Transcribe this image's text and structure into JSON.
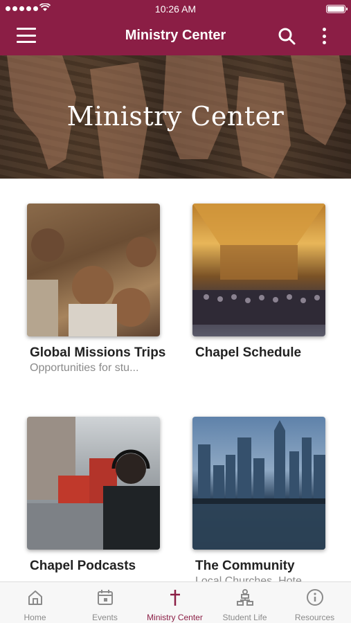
{
  "status_bar": {
    "time": "10:26 AM"
  },
  "nav": {
    "title": "Ministry Center"
  },
  "hero": {
    "title": "Ministry Center"
  },
  "cards": [
    {
      "title": "Global Missions Trips",
      "subtitle": "Opportunities for stu..."
    },
    {
      "title": "Chapel Schedule",
      "subtitle": ""
    },
    {
      "title": "Chapel Podcasts",
      "subtitle": ""
    },
    {
      "title": "The Community",
      "subtitle": "Local Churches, Hote"
    }
  ],
  "tabs": [
    {
      "label": "Home",
      "icon": "home-icon"
    },
    {
      "label": "Events",
      "icon": "calendar-icon"
    },
    {
      "label": "Ministry Center",
      "icon": "cross-icon"
    },
    {
      "label": "Student Life",
      "icon": "org-chart-icon"
    },
    {
      "label": "Resources",
      "icon": "info-icon"
    }
  ],
  "colors": {
    "brand": "#8b1e45",
    "tab_inactive": "#8a8a8a"
  }
}
